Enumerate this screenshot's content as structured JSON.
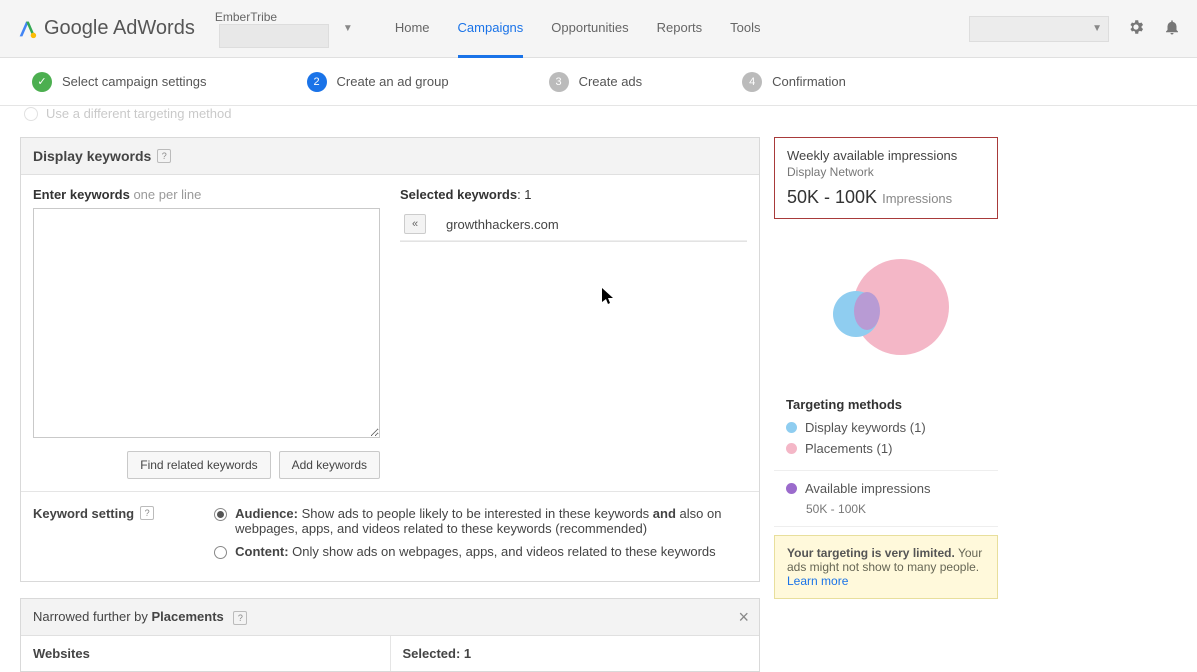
{
  "header": {
    "brand": "Google AdWords",
    "account": "EmberTribe",
    "nav": [
      "Home",
      "Campaigns",
      "Opportunities",
      "Reports",
      "Tools"
    ],
    "active_nav": "Campaigns"
  },
  "steps": [
    {
      "label": "Select campaign settings",
      "state": "done"
    },
    {
      "label": "Create an ad group",
      "state": "active",
      "num": "2"
    },
    {
      "label": "Create ads",
      "state": "todo",
      "num": "3"
    },
    {
      "label": "Confirmation",
      "state": "todo",
      "num": "4"
    }
  ],
  "cutoff_option": "Use a different targeting method",
  "display_keywords": {
    "title": "Display keywords",
    "enter_label": "Enter keywords",
    "enter_hint": "one per line",
    "find_btn": "Find related keywords",
    "add_btn": "Add keywords",
    "selected_label": "Selected keywords",
    "selected_count": "1",
    "selected_items": [
      "growthhackers.com"
    ]
  },
  "keyword_setting": {
    "title": "Keyword setting",
    "audience_label": "Audience:",
    "audience_text_a": " Show ads to people likely to be interested in these keywords ",
    "audience_bold": "and",
    "audience_text_b": " also on webpages, apps, and videos related to these keywords (recommended)",
    "content_label": "Content:",
    "content_text": " Only show ads on webpages, apps, and videos related to these keywords"
  },
  "narrowed": {
    "title_a": "Narrowed further by ",
    "title_b": "Placements",
    "col1": "Websites",
    "col2": "Selected: 1"
  },
  "impressions": {
    "title": "Weekly available impressions",
    "sub": "Display Network",
    "range": "50K - 100K",
    "label": "Impressions"
  },
  "targeting_methods": {
    "title": "Targeting methods",
    "items": [
      {
        "color": "blue",
        "label": "Display keywords (1)"
      },
      {
        "color": "pink",
        "label": "Placements (1)"
      }
    ]
  },
  "available": {
    "label": "Available impressions",
    "sub": "50K - 100K"
  },
  "warning": {
    "bold": "Your targeting is very limited.",
    "text": " Your ads might not show to many people.",
    "link": "Learn more"
  }
}
